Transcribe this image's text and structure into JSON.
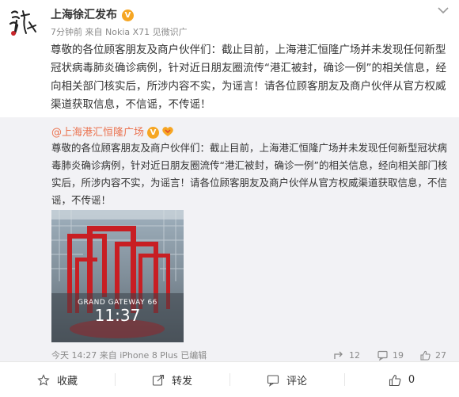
{
  "post": {
    "author": "上海徐汇发布",
    "time": "7分钟前",
    "source": "来自 Nokia X71 见微识广",
    "text": "尊敬的各位顾客朋友及商户伙伴们：截止目前，上海港汇恒隆广场并未发现任何新型冠状病毒肺炎确诊病例，针对近日朋友圈流传“港汇被封，确诊一例”的相关信息，经向相关部门核实后，所涉内容不实，为谣言！请各位顾客朋友及商户伙伴从官方权威渠道获取信息，不信谣，不传谣！"
  },
  "repost": {
    "author": "@上海港汇恒隆广场",
    "text": "尊敬的各位顾客朋友及商户伙伴们：截止目前，上海港汇恒隆广场并未发现任何新型冠状病毒肺炎确诊病例，针对近日朋友圈流传“港汇被封，确诊一例”的相关信息，经向相关部门核实后，所涉内容不实，为谣言！请各位顾客朋友及商户伙伴从官方权威渠道获取信息，不信谣，不传谣！",
    "image": {
      "brand": "GRAND GATEWAY 66",
      "clock": "11:37"
    },
    "footer": {
      "source": "今天 14:27 来自 iPhone 8 Plus  已编辑",
      "reposts": "12",
      "comments": "19",
      "likes": "27"
    }
  },
  "actions": {
    "favorite": "收藏",
    "forward": "转发",
    "comment": "评论",
    "like": "0"
  },
  "colors": {
    "accent": "#eb7350",
    "verify": "#f6a623",
    "muted": "#8a8a8a",
    "repost_bg": "#f2f2f5"
  }
}
